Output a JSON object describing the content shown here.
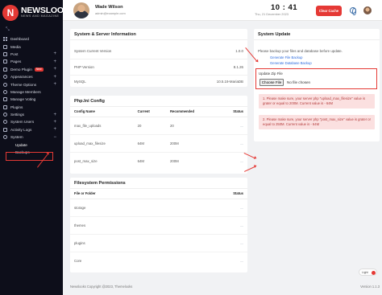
{
  "brand": {
    "name": "NEWSLOOKS",
    "tagline": "NEWS AND MAGAZINE",
    "logo_letter": "N"
  },
  "sidebar": {
    "toggle_icon": "collapse-icon",
    "items": [
      {
        "label": "Dashboard",
        "icon": "dashboard-icon",
        "expand": ""
      },
      {
        "label": "Media",
        "icon": "media-icon",
        "expand": ""
      },
      {
        "label": "Post",
        "icon": "post-icon",
        "expand": "+"
      },
      {
        "label": "Pages",
        "icon": "pages-icon",
        "expand": "+"
      },
      {
        "label": "Demo Plugin",
        "icon": "plugin-icon",
        "expand": "+",
        "badge": "New"
      },
      {
        "label": "Appearances",
        "icon": "appearance-icon",
        "expand": "+"
      },
      {
        "label": "Theme Options",
        "icon": "theme-icon",
        "expand": "+"
      },
      {
        "label": "Manage Members",
        "icon": "members-icon",
        "expand": ""
      },
      {
        "label": "Manage Voting",
        "icon": "voting-icon",
        "expand": ""
      },
      {
        "label": "Plugins",
        "icon": "plugins-icon",
        "expand": ""
      },
      {
        "label": "Settings",
        "icon": "settings-icon",
        "expand": "+"
      },
      {
        "label": "System Users",
        "icon": "users-icon",
        "expand": "+"
      },
      {
        "label": "Activity Logs",
        "icon": "logs-icon",
        "expand": "+"
      },
      {
        "label": "System",
        "icon": "system-icon",
        "expand": "−"
      }
    ],
    "subitems": [
      {
        "label": "Update",
        "active": true
      },
      {
        "label": "Backups",
        "active": false
      }
    ]
  },
  "header": {
    "user_name": "Wade Wilson",
    "user_email": "admin@example.com",
    "clock": "10 : 41",
    "date": "Thu, 21 December 2023",
    "clear_cache_label": "Clear Cache"
  },
  "system_info": {
    "title": "System & Server Information",
    "rows": [
      {
        "label": "System Current Version",
        "value": "1.0.0"
      },
      {
        "label": "PHP Version",
        "value": "8.1.26"
      },
      {
        "label": "MySQL",
        "value": "10.5.19-MariaDB"
      }
    ]
  },
  "php_config": {
    "title": "Php.Ini Config",
    "columns": [
      "Config Name",
      "Current",
      "Recommended",
      "Status"
    ],
    "rows": [
      {
        "name": "max_file_uploads",
        "current": "20",
        "recommended": "20",
        "status": "—"
      },
      {
        "name": "upload_max_filesize",
        "current": "64M",
        "recommended": "200M",
        "status": "—"
      },
      {
        "name": "post_max_size",
        "current": "64M",
        "recommended": "200M",
        "status": "—"
      }
    ]
  },
  "fs_permissions": {
    "title": "Filesystem Permissions",
    "columns": [
      "File or Folder",
      "Status"
    ],
    "rows": [
      {
        "name": "storage",
        "status": "—"
      },
      {
        "name": "themes",
        "status": "—"
      },
      {
        "name": "plugins",
        "status": "—"
      },
      {
        "name": "Core",
        "status": "—"
      }
    ]
  },
  "system_update": {
    "title": "System Update",
    "note": "Please backup your files and database before update.",
    "links": [
      "Generate File Backup",
      "Generate Database Backup"
    ],
    "upload_label": "Update Zip File",
    "file_button": "Choose File",
    "file_status": "No file chosen",
    "alerts": [
      "1. Please make sure, your server php \"upload_max_filesize\" value is grater or equal to 200M. Current value is - 64M",
      "2. Please make sure, your server php \"post_max_size\" value is grater or equal to 250M. Current value is - 64M"
    ]
  },
  "footer": {
    "copyright": "Newslooks Copyright @2023, Themelooks",
    "version": "Version 1.1.3"
  },
  "light_toggle_label": "Light",
  "colors": {
    "accent": "#e53935",
    "sidebar": "#0d0e1a",
    "link": "#2d6cdf",
    "alert_bg": "#fbe0e0"
  }
}
